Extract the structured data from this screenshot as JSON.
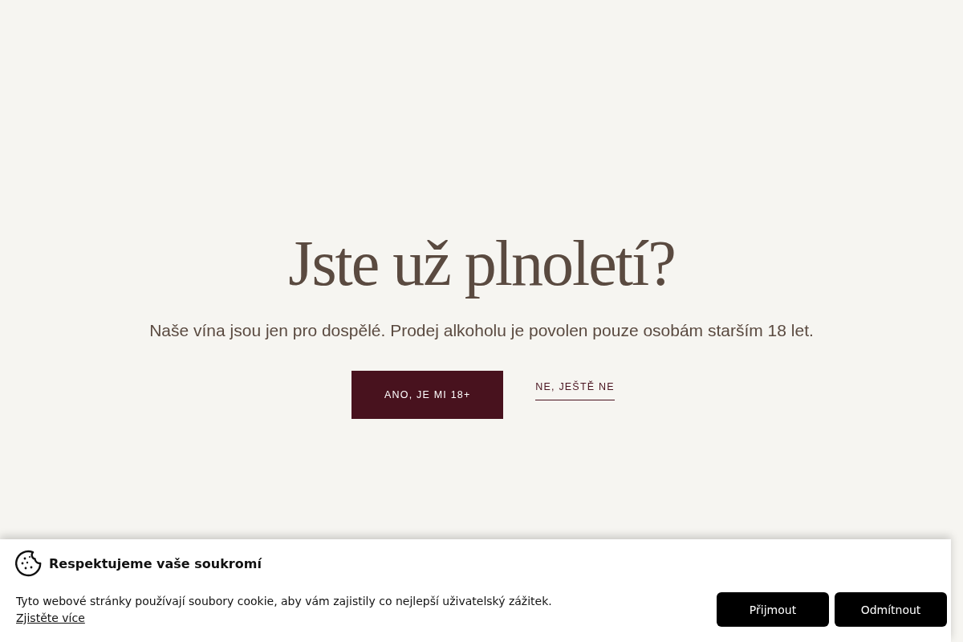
{
  "age_gate": {
    "title": "Jste už plnoletí?",
    "message": "Naše vína jsou jen pro dospělé. Prodej alkoholu je povolen pouze osobám starším 18 let.",
    "buttons": [
      {
        "label": "ANO, JE MI 18+",
        "kind": "primary"
      },
      {
        "label": "NE, JEŠTĚ NE",
        "kind": "link"
      }
    ]
  },
  "cookie_banner": {
    "title": "Respektujeme vaše soukromí",
    "text": "Tyto webové stránky používají soubory cookie, aby vám zajistily co nejlepší uživatelský zážitek.",
    "link": "Zjistěte více",
    "buttons": [
      "Přijmout",
      "Odmítnout"
    ]
  }
}
